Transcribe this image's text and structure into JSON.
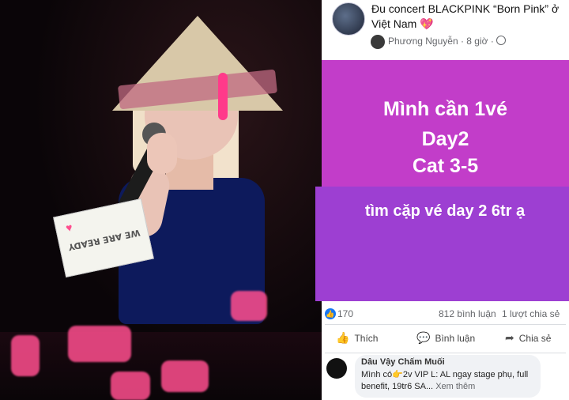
{
  "photo": {
    "sign_text": "WE ARE READY"
  },
  "post": {
    "group_title": "Đu concert BLACKPINK “Born Pink” ở Việt Nam 💖",
    "author": "Phương Nguyễn",
    "time": "· 8 giờ ·",
    "card1_lines": [
      "Mình cần 1vé",
      "Day2",
      "Cat 3-5"
    ],
    "card2_text": "tìm cặp vé day 2 6tr ạ",
    "likes": "170",
    "comments": "812 bình luận",
    "shares": "1 lượt chia sẻ",
    "actions": {
      "like": "Thích",
      "comment": "Bình luận",
      "share": "Chia sẻ"
    },
    "comment": {
      "author": "Dâu Vậy Chấm Muối",
      "text": "Mình có👉2v VIP L: AL ngay stage phụ, full benefit, 19tr6 SA...",
      "more": "Xem thêm"
    }
  }
}
